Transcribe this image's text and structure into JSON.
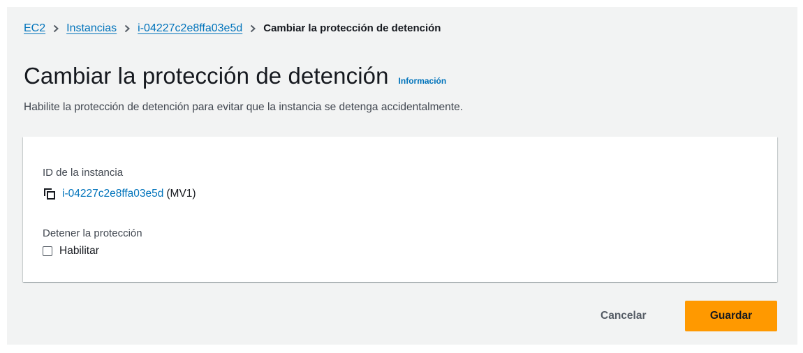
{
  "breadcrumb": {
    "items": [
      "EC2",
      "Instancias",
      "i-04227c2e8ffa03e5d"
    ],
    "current": "Cambiar la protección de detención"
  },
  "header": {
    "title": "Cambiar la protección de detención",
    "info_link": "Información",
    "description": "Habilite la protección de detención para evitar que la instancia se detenga accidentalmente."
  },
  "panel": {
    "id_label": "ID de la instancia",
    "instance_id": "i-04227c2e8ffa03e5d",
    "instance_name": "(MV1)",
    "stop_label": "Detener la protección",
    "checkbox_label": "Habilitar",
    "checkbox_checked": false
  },
  "actions": {
    "cancel_label": "Cancelar",
    "save_label": "Guardar"
  },
  "colors": {
    "link": "#0073bb",
    "primary_button": "#ff9900",
    "background": "#f2f3f3"
  },
  "icons": [
    "chevron-right-icon",
    "copy-icon"
  ]
}
